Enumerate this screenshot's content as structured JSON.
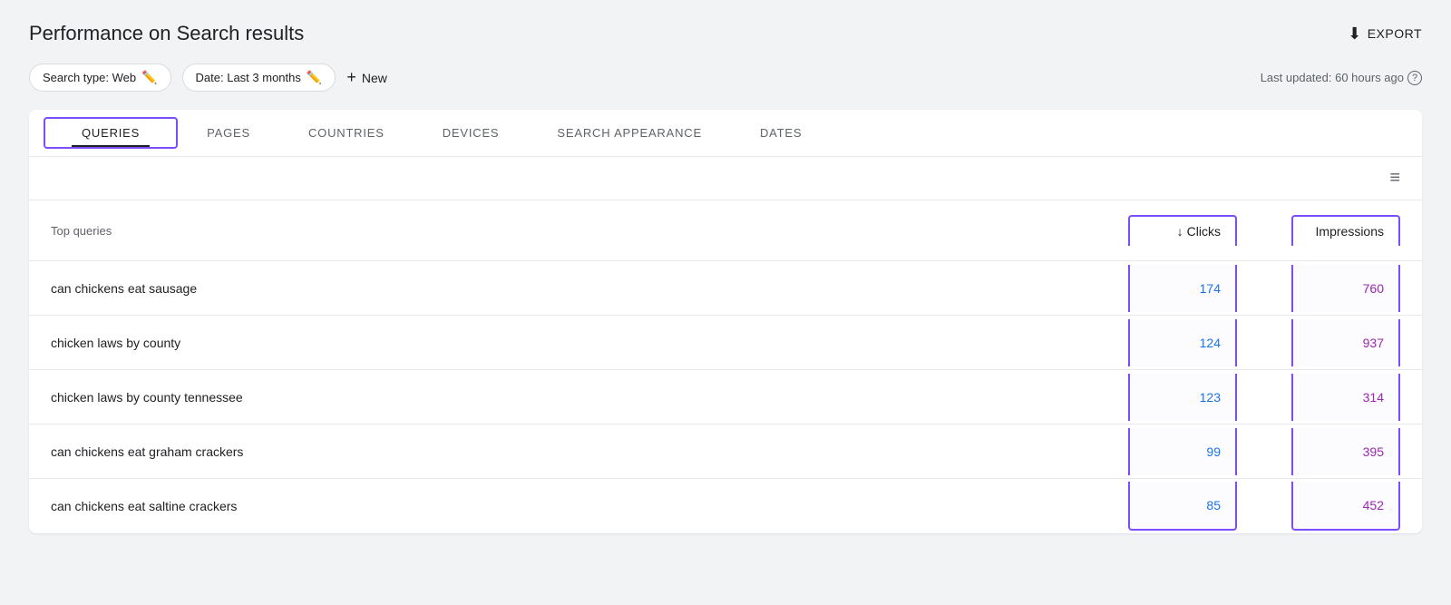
{
  "page": {
    "title": "Performance on Search results",
    "export_label": "EXPORT",
    "last_updated": "Last updated: 60 hours ago"
  },
  "filters": {
    "search_type_label": "Search type: Web",
    "date_label": "Date: Last 3 months",
    "new_label": "New"
  },
  "tabs": [
    {
      "id": "queries",
      "label": "QUERIES",
      "active": true
    },
    {
      "id": "pages",
      "label": "PAGES",
      "active": false
    },
    {
      "id": "countries",
      "label": "COUNTRIES",
      "active": false
    },
    {
      "id": "devices",
      "label": "DEVICES",
      "active": false
    },
    {
      "id": "search_appearance",
      "label": "SEARCH APPEARANCE",
      "active": false
    },
    {
      "id": "dates",
      "label": "DATES",
      "active": false
    }
  ],
  "table": {
    "header": {
      "query_label": "Top queries",
      "clicks_label": "Clicks",
      "impressions_label": "Impressions"
    },
    "rows": [
      {
        "query": "can chickens eat sausage",
        "clicks": "174",
        "impressions": "760"
      },
      {
        "query": "chicken laws by county",
        "clicks": "124",
        "impressions": "937"
      },
      {
        "query": "chicken laws by county tennessee",
        "clicks": "123",
        "impressions": "314"
      },
      {
        "query": "can chickens eat graham crackers",
        "clicks": "99",
        "impressions": "395"
      },
      {
        "query": "can chickens eat saltine crackers",
        "clicks": "85",
        "impressions": "452"
      }
    ]
  }
}
